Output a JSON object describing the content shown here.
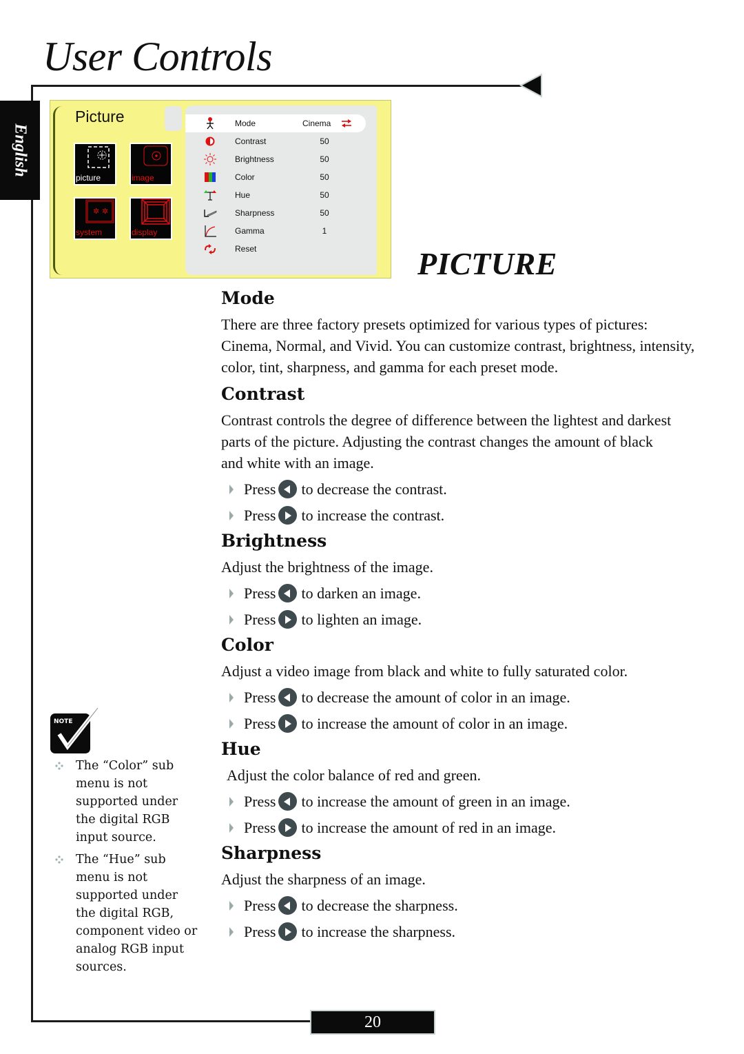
{
  "header": {
    "title": "User Controls"
  },
  "language_tab": {
    "label": "English"
  },
  "section_title": "PICTURE",
  "osd_menu": {
    "title": "Picture",
    "tiles": [
      {
        "label": "picture",
        "icon": "picture-icon",
        "label_color": "#ffffff"
      },
      {
        "label": "image",
        "icon": "image-icon",
        "label_color": "#e01010"
      },
      {
        "label": "system",
        "icon": "system-icon",
        "label_color": "#e01010"
      },
      {
        "label": "display",
        "icon": "display-icon",
        "label_color": "#e01010"
      }
    ],
    "rows": [
      {
        "label": "Mode",
        "value": "Cinema",
        "icon": "mode-person-icon",
        "selected": true
      },
      {
        "label": "Contrast",
        "value": "50",
        "icon": "contrast-icon"
      },
      {
        "label": "Brightness",
        "value": "50",
        "icon": "brightness-sun-icon"
      },
      {
        "label": "Color",
        "value": "50",
        "icon": "color-bars-icon"
      },
      {
        "label": "Hue",
        "value": "50",
        "icon": "hue-balance-icon"
      },
      {
        "label": "Sharpness",
        "value": "50",
        "icon": "sharpness-icon"
      },
      {
        "label": "Gamma",
        "value": "1",
        "icon": "gamma-curve-icon"
      },
      {
        "label": "Reset",
        "value": "",
        "icon": "reset-arrows-icon"
      }
    ],
    "colors": {
      "background": "#f7f48a",
      "panel": "#e7e9e9",
      "accent": "#e01010"
    }
  },
  "sections": [
    {
      "heading": "Mode",
      "text": "There are three factory presets optimized for various types of pictures: Cinema, Normal, and Vivid. You can customize contrast, brightness, intensity, color, tint, sharpness, and gamma for each preset mode.",
      "steps": []
    },
    {
      "heading": "Contrast",
      "text": "Contrast controls the degree of difference between the lightest and darkest parts of the picture. Adjusting the contrast changes the amount of black and white with an image.",
      "steps": [
        {
          "press": "Press",
          "button": "left",
          "action": "to decrease the contrast."
        },
        {
          "press": "Press",
          "button": "right",
          "action": "to increase the contrast."
        }
      ]
    },
    {
      "heading": "Brightness",
      "text": "Adjust the brightness of the image.",
      "steps": [
        {
          "press": "Press",
          "button": "left",
          "action": "to darken an image."
        },
        {
          "press": "Press",
          "button": "right",
          "action": "to lighten an image."
        }
      ]
    },
    {
      "heading": "Color",
      "text": "Adjust a video image from black and white to fully saturated color.",
      "steps": [
        {
          "press": "Press",
          "button": "left",
          "action": "to decrease the amount of color in an image."
        },
        {
          "press": "Press",
          "button": "right",
          "action": "to increase the amount of color in an image."
        }
      ]
    },
    {
      "heading": "Hue",
      "text": "Adjust the color balance of red and green.",
      "steps": [
        {
          "press": "Press",
          "button": "left",
          "action": "to increase the amount of green in an image."
        },
        {
          "press": "Press",
          "button": "right",
          "action": "to increase the amount of red in an image."
        }
      ]
    },
    {
      "heading": "Sharpness",
      "text": "Adjust the sharpness of an image.",
      "steps": [
        {
          "press": "Press",
          "button": "left",
          "action": "to decrease the sharpness."
        },
        {
          "press": "Press",
          "button": "right",
          "action": "to increase the sharpness."
        }
      ]
    }
  ],
  "note": {
    "icon_label": "NOTE",
    "items": [
      "The “Color” sub menu is not supported under the digital RGB input source.",
      "The “Hue” sub menu is not supported under the digital RGB, component video or analog RGB input sources."
    ]
  },
  "footer": {
    "page_number": "20"
  }
}
